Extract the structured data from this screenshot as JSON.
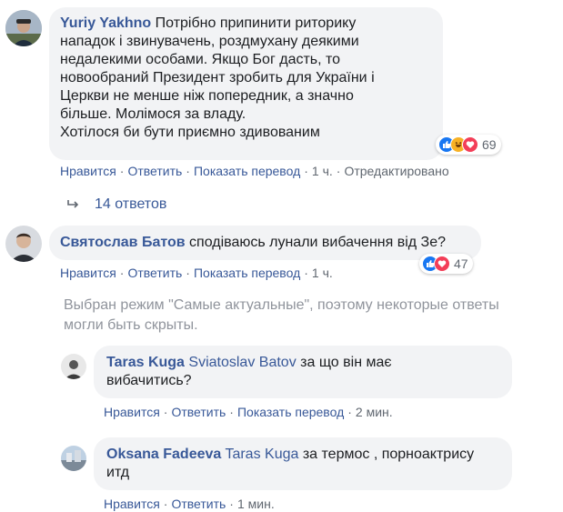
{
  "colors": {
    "link": "#385898",
    "meta": "#606770",
    "bubble": "#f2f3f5",
    "like": "#1877f2",
    "love": "#f33e58",
    "haha": "#f7b125"
  },
  "comments": [
    {
      "author": "Yuriy Yakhno",
      "text_lines": [
        "Потрібно припинити риторику",
        "нападок і звинувачень, роздмухану деякими",
        "недалекими особами. Якщо Бог дасть, то",
        "новообраний Президент зробить для України і",
        "Церкви не менше ніж попередник, а значно",
        "більше. Молімося за владу.",
        "Хотілося би бути приємно здивованим"
      ],
      "reaction_count": "69",
      "reaction_icons": [
        "like-icon",
        "haha-icon",
        "love-icon"
      ],
      "actions": {
        "like": "Нравится",
        "reply": "Ответить",
        "translate": "Показать перевод",
        "time": "1 ч.",
        "edited": "Отредактировано"
      },
      "replies_link": "14 ответов"
    },
    {
      "author": "Святослав Батов",
      "text": "сподіваюсь лунали вибачення від Зе?",
      "reaction_count": "47",
      "reaction_icons": [
        "like-icon",
        "love-icon"
      ],
      "actions": {
        "like": "Нравится",
        "reply": "Ответить",
        "translate": "Показать перевод",
        "time": "1 ч."
      }
    }
  ],
  "notice": "Выбран режим \"Самые актуальные\", поэтому некоторые ответы могли быть скрыты.",
  "replies": [
    {
      "author": "Taras Kuga",
      "mention": "Sviatoslav Batov",
      "text_line1": "за що він має",
      "text_line2": "вибачитись?",
      "actions": {
        "like": "Нравится",
        "reply": "Ответить",
        "translate": "Показать перевод",
        "time": "2 мин."
      }
    },
    {
      "author": "Oksana Fadeeva",
      "mention": "Taras Kuga",
      "text_line1": "за термос , порноактрису",
      "text_line2": "итд",
      "actions": {
        "like": "Нравится",
        "reply": "Ответить",
        "time": "1 мин."
      }
    }
  ]
}
